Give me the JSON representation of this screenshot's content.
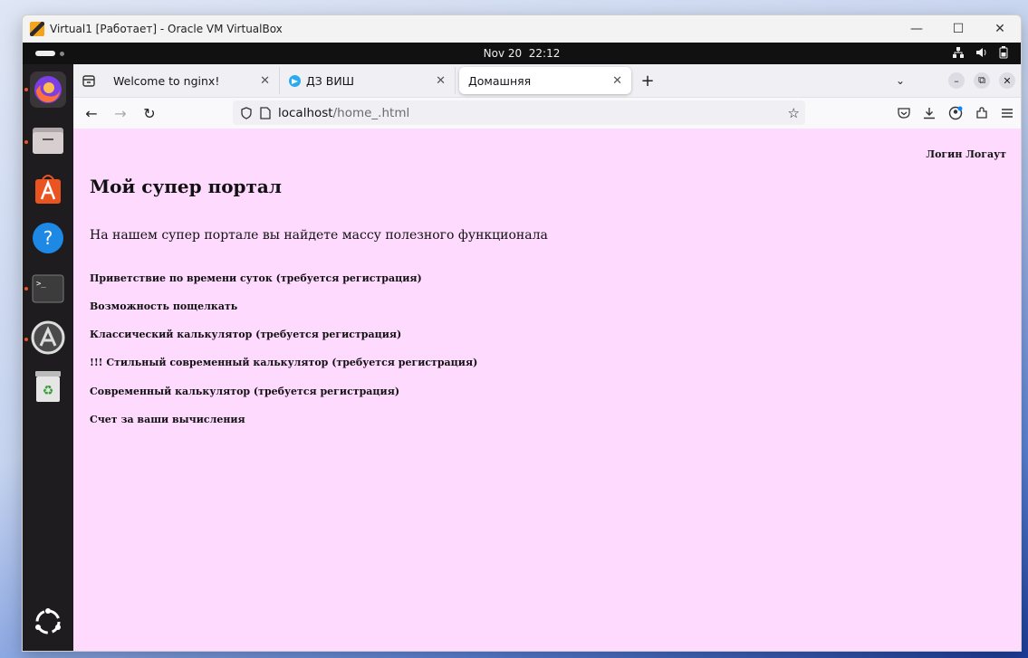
{
  "vbox": {
    "title": "Virtual1 [Работает] - Oracle VM VirtualBox",
    "minimize_label": "—",
    "maximize_label": "☐",
    "close_label": "✕"
  },
  "topbar": {
    "date": "Nov 20",
    "time": "22:12"
  },
  "dock": {
    "apps": [
      "firefox-icon",
      "files-icon",
      "app-center-icon",
      "help-icon",
      "terminal-icon",
      "software-updater-icon",
      "trash-icon",
      "show-apps-icon"
    ]
  },
  "browser": {
    "tabs": [
      {
        "title": "Welcome to nginx!"
      },
      {
        "title": "ДЗ ВИШ"
      },
      {
        "title": "Домашняя"
      }
    ],
    "url_host": "localhost",
    "url_path": "/home_.html"
  },
  "page": {
    "login_logout": "Логин Логаут",
    "heading": "Мой супер портал",
    "lead": "На нашем супер портале вы найдете массу полезного функционала",
    "features": [
      "Приветствие по времени суток (требуется регистрация)",
      "Возможность пощелкать",
      "Классический калькулятор (требуется регистрация)",
      "!!! Стильный современный калькулятор (требуется регистрация)",
      "Современный калькулятор (требуется регистрация)",
      "Счет за ваши вычисления"
    ],
    "background": "#ffdaff"
  }
}
